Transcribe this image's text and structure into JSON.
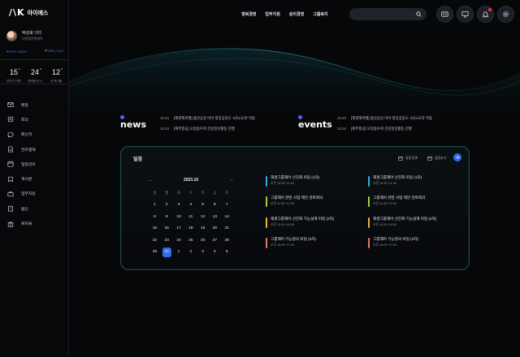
{
  "brand": {
    "mark": "/\\K",
    "name": "아이에스"
  },
  "profile": {
    "name": "박성호",
    "role": "대리",
    "dept": "디지털전략파트"
  },
  "quota": {
    "left": "20% / 300%",
    "right": "2005 / 11%"
  },
  "stats": [
    {
      "num": "15",
      "label": "연차/전 개인"
    },
    {
      "num": "24",
      "label": "결재함 문서"
    },
    {
      "num": "12",
      "label": "내 게시물"
    }
  ],
  "menu": [
    "메일",
    "회의",
    "메신저",
    "전자결재",
    "일정관리",
    "게시판",
    "업무지원",
    "법인",
    "복지몰"
  ],
  "topnav": [
    "행복경영",
    "업무지원",
    "윤리경영",
    "그룹복지"
  ],
  "search": {
    "value": ""
  },
  "news": {
    "title": "news",
    "items": [
      {
        "date": "10.24",
        "text": "[해경해피밸] 울산공장 이어 청양공장도 '4조2교대' 적용"
      },
      {
        "date": "10.24",
        "text": "[제주항공] 오렁송우회 건강증진활동 진행"
      }
    ]
  },
  "events_feed": {
    "title": "events",
    "items": [
      {
        "date": "10.24",
        "text": "[해경해피밸] 울산공장 이어 청양공장도 '4조2교대' 적용"
      },
      {
        "date": "10.24",
        "text": "[제주항공] 오렁송우회 건강증진활동 진행"
      }
    ]
  },
  "calendar": {
    "panel_title": "일정",
    "action_add": "일정 등록",
    "action_view": "일정추가",
    "month": "2023.10",
    "weekdays": [
      "일",
      "월",
      "화",
      "수",
      "목",
      "금",
      "토"
    ],
    "days": [
      "1",
      "2",
      "3",
      "4",
      "5",
      "6",
      "7",
      "8",
      "9",
      "10",
      "11",
      "12",
      "13",
      "14",
      "15",
      "16",
      "17",
      "18",
      "19",
      "20",
      "21",
      "22",
      "23",
      "24",
      "25",
      "26",
      "27",
      "28",
      "29",
      "30",
      "1",
      "2",
      "3",
      "4",
      "5"
    ],
    "selected": "30"
  },
  "schedule_left": [
    {
      "title": "해경그룹해어 선진화 미팅 (1차)",
      "time": "오전 10:30~11:30",
      "color": "#2bb3d6"
    },
    {
      "title": "그룹해어 관련 사업 제안 검토회의",
      "time": "오전 11:30~12:00",
      "color": "#9bd34a"
    },
    {
      "title": "해경그룹해어 선진화 기능설계 미팅 (2차)",
      "time": "오후 13:30~15:30",
      "color": "#f0b23a"
    },
    {
      "title": "그룹해어 기능정의 미팅 (2차)",
      "time": "오후 16:00~17:00",
      "color": "#e07a6a"
    }
  ],
  "schedule_right": [
    {
      "title": "해경그룹해어 선진화 미팅 (1차)",
      "time": "오전 10:30~11:30",
      "color": "#2bb3d6"
    },
    {
      "title": "그룹해어 관련 사업 제안 검토회의",
      "time": "오전 11:30~12:00",
      "color": "#9bd34a"
    },
    {
      "title": "해경그룹해어 선진화 기능설계 미팅 (2차)",
      "time": "오후 13:30~15:30",
      "color": "#f0b23a"
    },
    {
      "title": "그룹해어 기능정의 미팅 (2차)",
      "time": "오후 16:00~17:00",
      "color": "#e07a6a"
    }
  ]
}
